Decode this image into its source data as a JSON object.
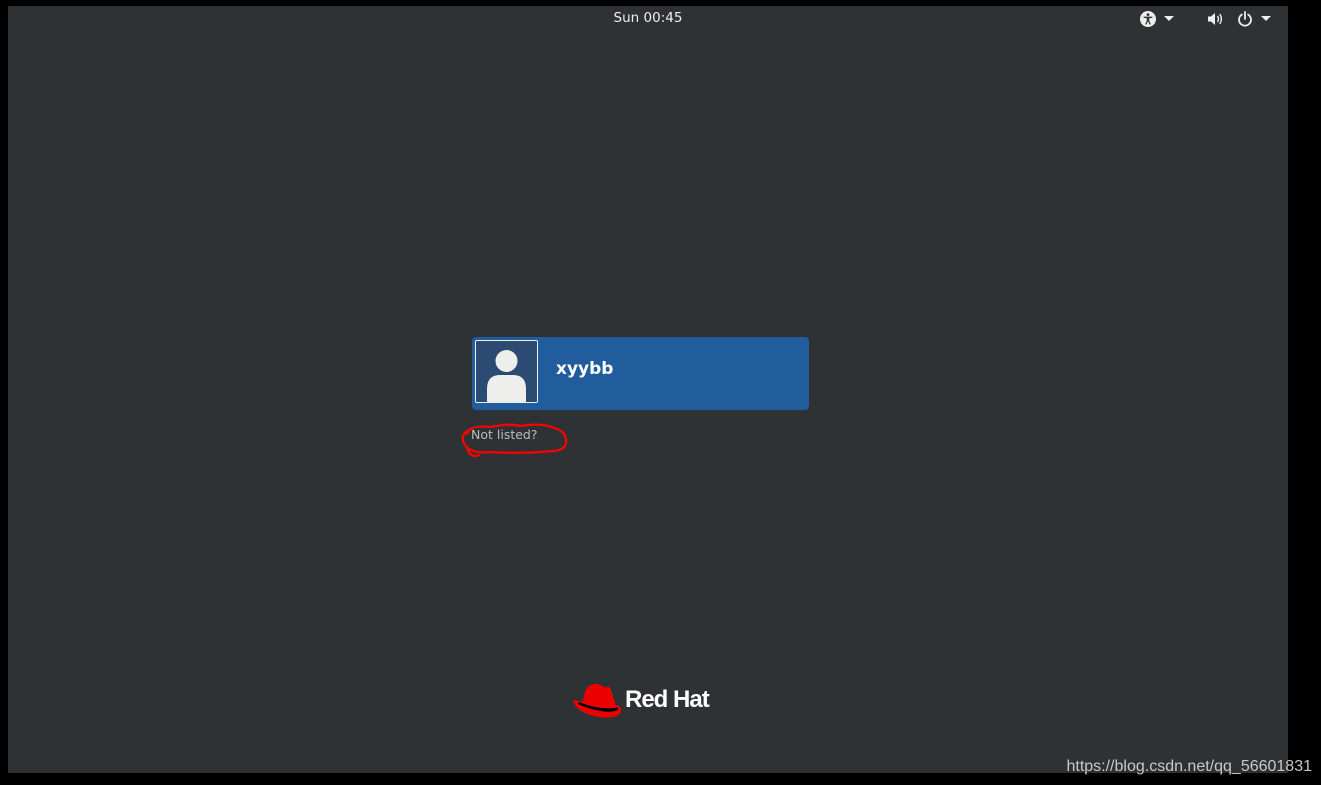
{
  "topbar": {
    "clock": "Sun 00:45",
    "icons": [
      "accessibility-icon",
      "chevron-down-icon",
      "volume-icon",
      "power-icon",
      "chevron-down-icon"
    ]
  },
  "users": [
    {
      "name": "xyybb",
      "avatar_icon": "user-avatar-icon"
    }
  ],
  "not_listed_label": "Not listed?",
  "logo": {
    "text": "Red Hat",
    "icon": "red-hat-fedora-icon"
  },
  "watermark": "https://blog.csdn.net/qq_56601831",
  "colors": {
    "background": "#2f3234",
    "user_card": "#215d9c",
    "annotation": "#ff0000",
    "brand_red": "#ee0000"
  }
}
